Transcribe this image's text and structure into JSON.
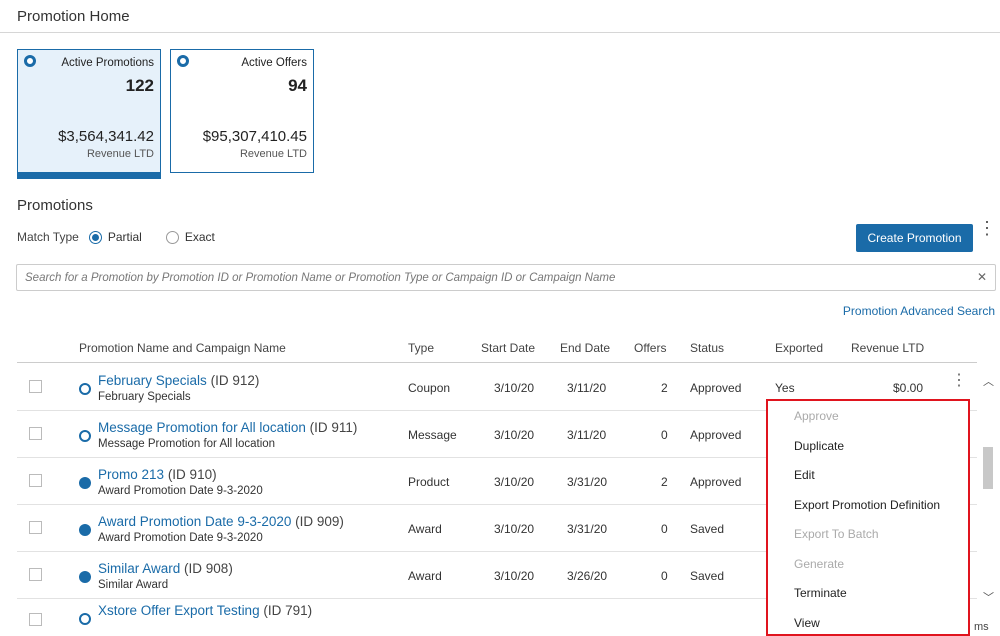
{
  "header": {
    "title": "Promotion Home"
  },
  "cards": [
    {
      "label": "Active Promotions",
      "count": "122",
      "revenue": "$3,564,341.42",
      "revenue_label": "Revenue LTD",
      "selected": true
    },
    {
      "label": "Active Offers",
      "count": "94",
      "revenue": "$95,307,410.45",
      "revenue_label": "Revenue LTD",
      "selected": false
    }
  ],
  "promotions": {
    "title": "Promotions",
    "match_type_label": "Match Type",
    "match_options": [
      "Partial",
      "Exact"
    ],
    "match_selected": "Partial",
    "create_button": "Create Promotion",
    "search_placeholder": "Search for a Promotion by Promotion ID or Promotion Name or Promotion Type or Campaign ID or Campaign Name",
    "clear_icon": "✕",
    "advanced_search": "Promotion Advanced Search"
  },
  "table": {
    "columns": [
      "Promotion Name and Campaign Name",
      "Type",
      "Start Date",
      "End Date",
      "Offers",
      "Status",
      "Exported",
      "Revenue LTD"
    ],
    "rows": [
      {
        "name": "February Specials",
        "id": "(ID 912)",
        "campaign": "February Specials",
        "type": "Coupon",
        "start": "3/10/20",
        "end": "3/11/20",
        "offers": "2",
        "status": "Approved",
        "exported": "Yes",
        "revenue": "$0.00",
        "icon": "open"
      },
      {
        "name": "Message Promotion for All location",
        "id": "(ID 911)",
        "campaign": "Message Promotion for All location",
        "type": "Message",
        "start": "3/10/20",
        "end": "3/11/20",
        "offers": "0",
        "status": "Approved",
        "exported": "",
        "revenue": "",
        "icon": "open"
      },
      {
        "name": "Promo 213",
        "id": "(ID 910)",
        "campaign": "Award Promotion Date 9-3-2020",
        "type": "Product",
        "start": "3/10/20",
        "end": "3/31/20",
        "offers": "2",
        "status": "Approved",
        "exported": "",
        "revenue": "",
        "icon": "filled"
      },
      {
        "name": "Award Promotion Date 9-3-2020",
        "id": "(ID 909)",
        "campaign": "Award Promotion Date 9-3-2020",
        "type": "Award",
        "start": "3/10/20",
        "end": "3/31/20",
        "offers": "0",
        "status": "Saved",
        "exported": "",
        "revenue": "",
        "icon": "filled"
      },
      {
        "name": "Similar Award",
        "id": "(ID 908)",
        "campaign": "Similar Award",
        "type": "Award",
        "start": "3/10/20",
        "end": "3/26/20",
        "offers": "0",
        "status": "Saved",
        "exported": "",
        "revenue": "",
        "icon": "filled"
      },
      {
        "name": "Xstore Offer Export Testing",
        "id": "(ID 791)",
        "campaign": "",
        "type": "",
        "start": "",
        "end": "",
        "offers": "",
        "status": "",
        "exported": "",
        "revenue": "",
        "icon": "open"
      }
    ]
  },
  "context_menu": {
    "items": [
      {
        "label": "Approve",
        "enabled": false
      },
      {
        "label": "Duplicate",
        "enabled": true
      },
      {
        "label": "Edit",
        "enabled": true
      },
      {
        "label": "Export Promotion Definition",
        "enabled": true
      },
      {
        "label": "Export To Batch",
        "enabled": false
      },
      {
        "label": "Generate",
        "enabled": false
      },
      {
        "label": "Terminate",
        "enabled": true
      },
      {
        "label": "View",
        "enabled": true
      }
    ]
  },
  "footer": {
    "truncated_text": "ms"
  },
  "colors": {
    "accent": "#1a6ba8",
    "highlight_border": "#e0141e",
    "card_selected_bg": "#e6f1fa"
  }
}
